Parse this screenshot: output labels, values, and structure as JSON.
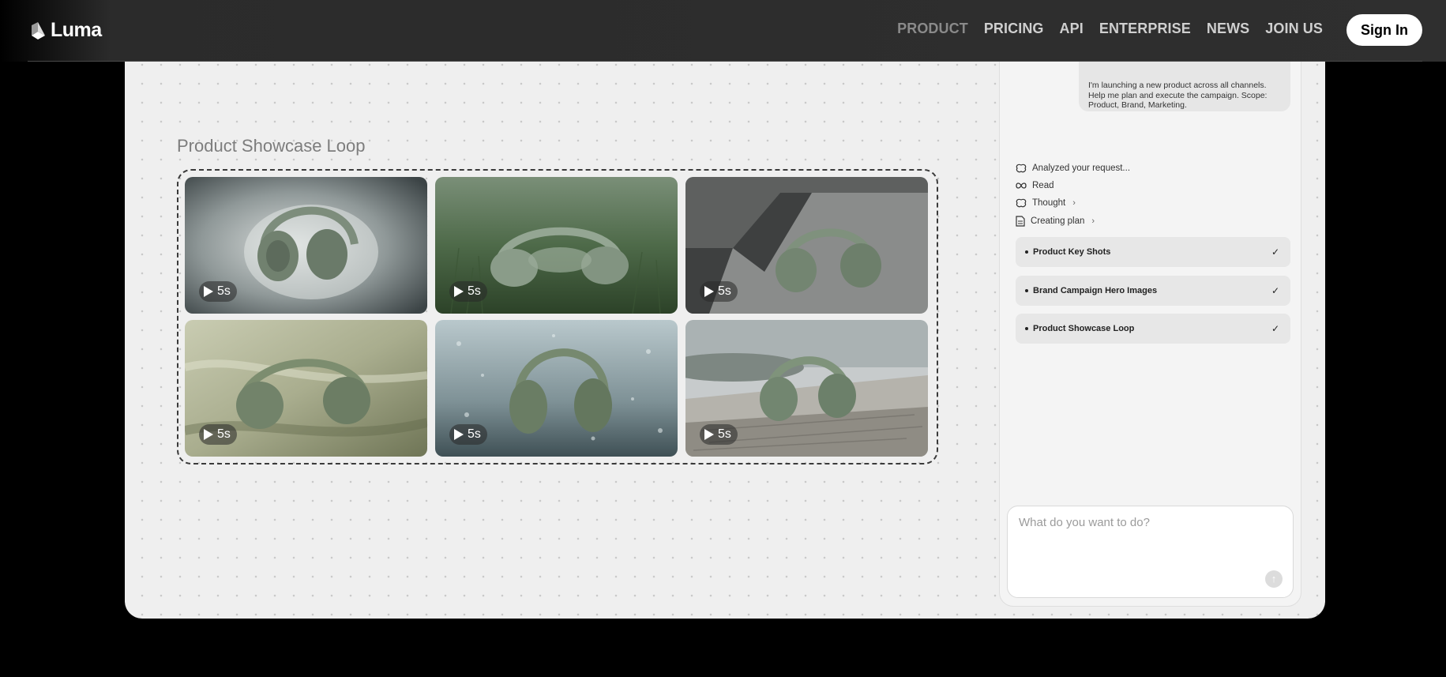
{
  "header": {
    "logo_text": "Luma",
    "nav": [
      "PRODUCT",
      "PRICING",
      "API",
      "ENTERPRISE",
      "NEWS",
      "JOIN US"
    ],
    "active_nav": "PRODUCT",
    "signin_label": "Sign In"
  },
  "showcase": {
    "title": "Product Showcase Loop",
    "thumbnails": [
      {
        "duration": "5s",
        "scene": "powder"
      },
      {
        "duration": "5s",
        "scene": "grass"
      },
      {
        "duration": "5s",
        "scene": "concrete-steps"
      },
      {
        "duration": "5s",
        "scene": "satin"
      },
      {
        "duration": "5s",
        "scene": "rain-glass"
      },
      {
        "duration": "5s",
        "scene": "driftwood"
      }
    ]
  },
  "chat": {
    "user_message": "I'm launching a new product across all channels. Help me plan and execute the campaign. Scope: Product, Brand, Marketing.",
    "steps": [
      {
        "icon": "brain-icon",
        "label": "Analyzed your request..."
      },
      {
        "icon": "infinity-icon",
        "label": "Read"
      },
      {
        "icon": "brain-icon",
        "label": "Thought",
        "chevron": "›"
      },
      {
        "icon": "document-icon",
        "label": "Creating plan",
        "chevron": "›"
      }
    ],
    "plan_items": [
      {
        "label": "Product Key Shots",
        "check": "✓"
      },
      {
        "label": "Brand Campaign Hero Images",
        "check": "✓"
      },
      {
        "label": "Product Showcase Loop",
        "check": "✓"
      }
    ],
    "composer": {
      "placeholder": "What do you want to do?",
      "send_icon": "arrow-up-icon"
    }
  }
}
